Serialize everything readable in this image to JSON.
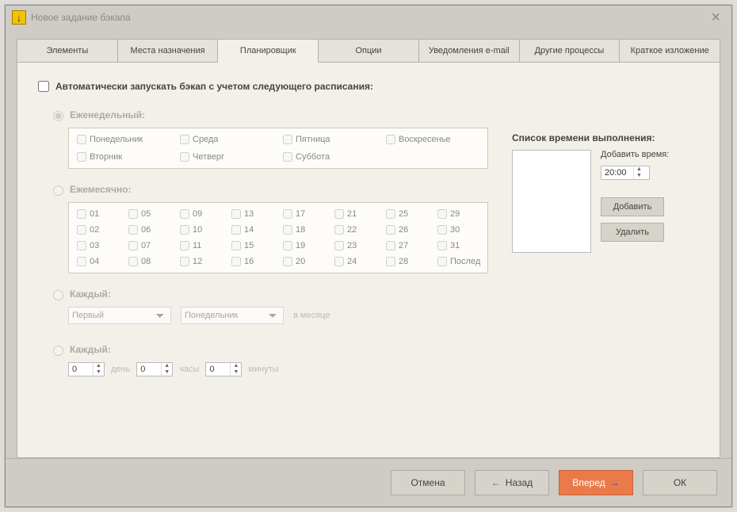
{
  "window": {
    "title": "Новое задание бэкапа"
  },
  "tabs": {
    "items": [
      {
        "label": "Элементы"
      },
      {
        "label": "Места назначения"
      },
      {
        "label": "Планировщик"
      },
      {
        "label": "Опции"
      },
      {
        "label": "Уведомления e-mail"
      },
      {
        "label": "Другие процессы"
      },
      {
        "label": "Краткое изложение"
      }
    ],
    "active": 2
  },
  "scheduler": {
    "auto_run_label": "Автоматически запускать бэкап с учетом следующего расписания:",
    "weekly": {
      "label": "Еженедельный:",
      "days": [
        "Понедельник",
        "Вторник",
        "Среда",
        "Четверг",
        "Пятница",
        "Суббота",
        "Воскресенье"
      ]
    },
    "monthly": {
      "label": "Ежемесячно:",
      "days": [
        "01",
        "02",
        "03",
        "04",
        "05",
        "06",
        "07",
        "08",
        "09",
        "10",
        "11",
        "12",
        "13",
        "14",
        "15",
        "16",
        "17",
        "18",
        "19",
        "20",
        "21",
        "22",
        "23",
        "24",
        "25",
        "26",
        "27",
        "28",
        "29",
        "30",
        "31",
        "Послед"
      ]
    },
    "every_nth": {
      "label": "Каждый:",
      "ordinal_options": [
        "Первый"
      ],
      "ordinal_value": "Первый",
      "day_options": [
        "Понедельник"
      ],
      "day_value": "Понедельник",
      "suffix": "в месяце"
    },
    "every_interval": {
      "label": "Каждый:",
      "day_value": "0",
      "day_label": "день",
      "hour_value": "0",
      "hour_label": "часы",
      "minute_value": "0",
      "minute_label": "минуты"
    },
    "time_list": {
      "header": "Список времени выполнения:",
      "add_time_label": "Добавить время:",
      "time_value": "20:00",
      "add_btn": "Добавить",
      "del_btn": "Удалить"
    }
  },
  "footer": {
    "cancel": "Отмена",
    "back": "Назад",
    "next": "Вперед",
    "ok": "ОК"
  }
}
